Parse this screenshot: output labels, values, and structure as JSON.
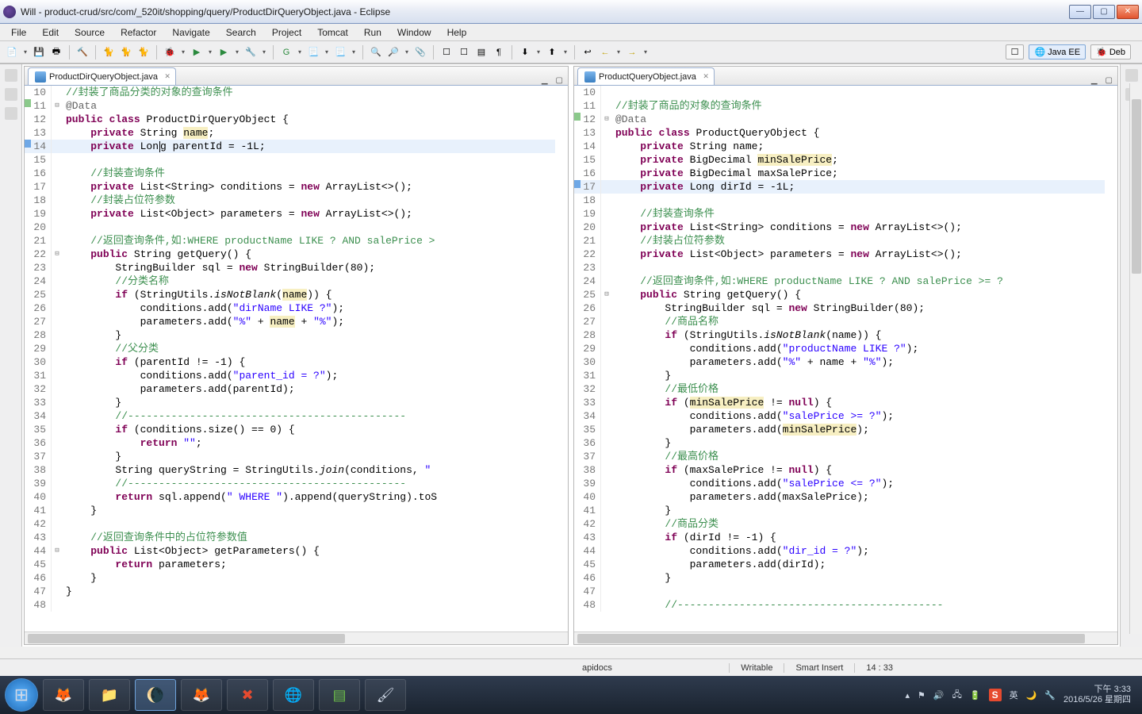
{
  "window": {
    "title": "Will - product-crud/src/com/_520it/shopping/query/ProductDirQueryObject.java - Eclipse",
    "min": "—",
    "max": "▢",
    "close": "✕"
  },
  "menu": [
    "File",
    "Edit",
    "Source",
    "Refactor",
    "Navigate",
    "Search",
    "Project",
    "Tomcat",
    "Run",
    "Window",
    "Help"
  ],
  "toolbar": {
    "icons": [
      "📄",
      "💾",
      "🖶",
      "🔨",
      "🏗",
      "🚀",
      "🐞",
      "🐈",
      "🔌",
      "📦",
      "G",
      "▶",
      "🔎",
      "🧩",
      "📎",
      "🔙",
      "🔜",
      "📂",
      "🔧",
      "⏯",
      "⏭",
      "⏮",
      "⬇",
      "⬆",
      "🔍",
      "🔗",
      "←",
      "→"
    ],
    "persp_open": "☐",
    "persp_javaee": "Java EE",
    "persp_debug": "Deb"
  },
  "left_tab": {
    "label": "ProductDirQueryObject.java",
    "close": "✕"
  },
  "right_tab": {
    "label": "ProductQueryObject.java",
    "close": "✕"
  },
  "status": {
    "apidocs": "apidocs",
    "writable": "Writable",
    "insert": "Smart Insert",
    "pos": "14 : 33"
  },
  "tray": {
    "ime": "S",
    "lang": "英",
    "ampm": "下午",
    "time": "3:33",
    "date": "2016/5/26 星期四"
  },
  "left_code": [
    {
      "n": 10,
      "cls": "",
      "fold": "",
      "html": "<span class='cm'>//封装了商品分类的对象的查询条件</span>"
    },
    {
      "n": 11,
      "cls": "",
      "fold": "⊟",
      "marker": "green",
      "html": "<span class='an'>@Data</span>"
    },
    {
      "n": 12,
      "cls": "",
      "fold": "",
      "html": "<span class='kw'>public</span> <span class='kw'>class</span> ProductDirQueryObject {"
    },
    {
      "n": 13,
      "cls": "",
      "fold": "",
      "html": "    <span class='kw'>private</span> String <span class='warn'>name</span>;"
    },
    {
      "n": 14,
      "cls": "hl",
      "fold": "",
      "marker": "blue",
      "html": "    <span class='kw'>private</span> Lon<span class='cursor'></span>g parentId = -1L;"
    },
    {
      "n": 15,
      "cls": "",
      "fold": "",
      "html": ""
    },
    {
      "n": 16,
      "cls": "",
      "fold": "",
      "html": "    <span class='cm'>//封装查询条件</span>"
    },
    {
      "n": 17,
      "cls": "",
      "fold": "",
      "html": "    <span class='kw'>private</span> List&lt;String&gt; conditions = <span class='kw'>new</span> ArrayList&lt;&gt;();"
    },
    {
      "n": 18,
      "cls": "",
      "fold": "",
      "html": "    <span class='cm'>//封装占位符参数</span>"
    },
    {
      "n": 19,
      "cls": "",
      "fold": "",
      "html": "    <span class='kw'>private</span> List&lt;Object&gt; parameters = <span class='kw'>new</span> ArrayList&lt;&gt;();"
    },
    {
      "n": 20,
      "cls": "",
      "fold": "",
      "html": ""
    },
    {
      "n": 21,
      "cls": "",
      "fold": "",
      "html": "    <span class='cm'>//返回查询条件,如:WHERE productName LIKE ? AND salePrice &gt;</span>"
    },
    {
      "n": 22,
      "cls": "",
      "fold": "⊟",
      "html": "    <span class='kw'>public</span> String getQuery() {"
    },
    {
      "n": 23,
      "cls": "",
      "fold": "",
      "html": "        StringBuilder sql = <span class='kw'>new</span> StringBuilder(80);"
    },
    {
      "n": 24,
      "cls": "",
      "fold": "",
      "html": "        <span class='cm'>//分类名称</span>"
    },
    {
      "n": 25,
      "cls": "",
      "fold": "",
      "html": "        <span class='kw'>if</span> (StringUtils.<span class='it'>isNotBlank</span>(<span class='warn'>name</span>)) {"
    },
    {
      "n": 26,
      "cls": "",
      "fold": "",
      "html": "            conditions.add(<span class='str'>\"dirName LIKE ?\"</span>);"
    },
    {
      "n": 27,
      "cls": "",
      "fold": "",
      "html": "            parameters.add(<span class='str'>\"%\"</span> + <span class='warn'>name</span> + <span class='str'>\"%\"</span>);"
    },
    {
      "n": 28,
      "cls": "",
      "fold": "",
      "html": "        }"
    },
    {
      "n": 29,
      "cls": "",
      "fold": "",
      "html": "        <span class='cm'>//父分类</span>"
    },
    {
      "n": 30,
      "cls": "",
      "fold": "",
      "html": "        <span class='kw'>if</span> (parentId != -1) {"
    },
    {
      "n": 31,
      "cls": "",
      "fold": "",
      "html": "            conditions.add(<span class='str'>\"parent_id = ?\"</span>);"
    },
    {
      "n": 32,
      "cls": "",
      "fold": "",
      "html": "            parameters.add(parentId);"
    },
    {
      "n": 33,
      "cls": "",
      "fold": "",
      "html": "        }"
    },
    {
      "n": 34,
      "cls": "",
      "fold": "",
      "html": "        <span class='cm'>//---------------------------------------------</span>"
    },
    {
      "n": 35,
      "cls": "",
      "fold": "",
      "html": "        <span class='kw'>if</span> (conditions.size() == 0) {"
    },
    {
      "n": 36,
      "cls": "",
      "fold": "",
      "html": "            <span class='kw'>return</span> <span class='str'>\"\"</span>;"
    },
    {
      "n": 37,
      "cls": "",
      "fold": "",
      "html": "        }"
    },
    {
      "n": 38,
      "cls": "",
      "fold": "",
      "html": "        String queryString = StringUtils.<span class='it'>join</span>(conditions, <span class='str'>\" </span>"
    },
    {
      "n": 39,
      "cls": "",
      "fold": "",
      "html": "        <span class='cm'>//---------------------------------------------</span>"
    },
    {
      "n": 40,
      "cls": "",
      "fold": "",
      "html": "        <span class='kw'>return</span> sql.append(<span class='str'>\" WHERE \"</span>).append(queryString).toS"
    },
    {
      "n": 41,
      "cls": "",
      "fold": "",
      "html": "    }"
    },
    {
      "n": 42,
      "cls": "",
      "fold": "",
      "html": ""
    },
    {
      "n": 43,
      "cls": "",
      "fold": "",
      "html": "    <span class='cm'>//返回查询条件中的占位符参数值</span>"
    },
    {
      "n": 44,
      "cls": "",
      "fold": "⊟",
      "html": "    <span class='kw'>public</span> List&lt;Object&gt; getParameters() {"
    },
    {
      "n": 45,
      "cls": "",
      "fold": "",
      "html": "        <span class='kw'>return</span> parameters;"
    },
    {
      "n": 46,
      "cls": "",
      "fold": "",
      "html": "    }"
    },
    {
      "n": 47,
      "cls": "",
      "fold": "",
      "html": "}"
    },
    {
      "n": 48,
      "cls": "",
      "fold": "",
      "html": ""
    }
  ],
  "right_code": [
    {
      "n": 10,
      "cls": "",
      "fold": "",
      "html": ""
    },
    {
      "n": 11,
      "cls": "",
      "fold": "",
      "html": "<span class='cm'>//封装了商品的对象的查询条件</span>"
    },
    {
      "n": 12,
      "cls": "",
      "fold": "⊟",
      "marker": "green",
      "html": "<span class='an'>@Data</span>"
    },
    {
      "n": 13,
      "cls": "",
      "fold": "",
      "html": "<span class='kw'>public</span> <span class='kw'>class</span> ProductQueryObject {"
    },
    {
      "n": 14,
      "cls": "",
      "fold": "",
      "html": "    <span class='kw'>private</span> String name;"
    },
    {
      "n": 15,
      "cls": "",
      "fold": "",
      "html": "    <span class='kw'>private</span> BigDecimal <span class='warn'>minSalePrice</span>;"
    },
    {
      "n": 16,
      "cls": "",
      "fold": "",
      "html": "    <span class='kw'>private</span> BigDecimal maxSalePrice;"
    },
    {
      "n": 17,
      "cls": "hl",
      "fold": "",
      "marker": "blue",
      "html": "    <span class='kw'>private</span> Long dirId = -1L;"
    },
    {
      "n": 18,
      "cls": "",
      "fold": "",
      "html": ""
    },
    {
      "n": 19,
      "cls": "",
      "fold": "",
      "html": "    <span class='cm'>//封装查询条件</span>"
    },
    {
      "n": 20,
      "cls": "",
      "fold": "",
      "html": "    <span class='kw'>private</span> List&lt;String&gt; conditions = <span class='kw'>new</span> ArrayList&lt;&gt;();"
    },
    {
      "n": 21,
      "cls": "",
      "fold": "",
      "html": "    <span class='cm'>//封装占位符参数</span>"
    },
    {
      "n": 22,
      "cls": "",
      "fold": "",
      "html": "    <span class='kw'>private</span> List&lt;Object&gt; parameters = <span class='kw'>new</span> ArrayList&lt;&gt;();"
    },
    {
      "n": 23,
      "cls": "",
      "fold": "",
      "html": ""
    },
    {
      "n": 24,
      "cls": "",
      "fold": "",
      "html": "    <span class='cm'>//返回查询条件,如:WHERE productName LIKE ? AND salePrice &gt;= ?</span>"
    },
    {
      "n": 25,
      "cls": "",
      "fold": "⊟",
      "html": "    <span class='kw'>public</span> String getQuery() {"
    },
    {
      "n": 26,
      "cls": "",
      "fold": "",
      "html": "        StringBuilder sql = <span class='kw'>new</span> StringBuilder(80);"
    },
    {
      "n": 27,
      "cls": "",
      "fold": "",
      "html": "        <span class='cm'>//商品名称</span>"
    },
    {
      "n": 28,
      "cls": "",
      "fold": "",
      "html": "        <span class='kw'>if</span> (StringUtils.<span class='it'>isNotBlank</span>(name)) {"
    },
    {
      "n": 29,
      "cls": "",
      "fold": "",
      "html": "            conditions.add(<span class='str'>\"productName LIKE ?\"</span>);"
    },
    {
      "n": 30,
      "cls": "",
      "fold": "",
      "html": "            parameters.add(<span class='str'>\"%\"</span> + name + <span class='str'>\"%\"</span>);"
    },
    {
      "n": 31,
      "cls": "",
      "fold": "",
      "html": "        }"
    },
    {
      "n": 32,
      "cls": "",
      "fold": "",
      "html": "        <span class='cm'>//最低价格</span>"
    },
    {
      "n": 33,
      "cls": "",
      "fold": "",
      "html": "        <span class='kw'>if</span> (<span class='warn'>minSalePrice</span> != <span class='kw'>null</span>) {"
    },
    {
      "n": 34,
      "cls": "",
      "fold": "",
      "html": "            conditions.add(<span class='str'>\"salePrice &gt;= ?\"</span>);"
    },
    {
      "n": 35,
      "cls": "",
      "fold": "",
      "html": "            parameters.add(<span class='warn'>minSalePrice</span>);"
    },
    {
      "n": 36,
      "cls": "",
      "fold": "",
      "html": "        }"
    },
    {
      "n": 37,
      "cls": "",
      "fold": "",
      "html": "        <span class='cm'>//最高价格</span>"
    },
    {
      "n": 38,
      "cls": "",
      "fold": "",
      "html": "        <span class='kw'>if</span> (maxSalePrice != <span class='kw'>null</span>) {"
    },
    {
      "n": 39,
      "cls": "",
      "fold": "",
      "html": "            conditions.add(<span class='str'>\"salePrice &lt;= ?\"</span>);"
    },
    {
      "n": 40,
      "cls": "",
      "fold": "",
      "html": "            parameters.add(maxSalePrice);"
    },
    {
      "n": 41,
      "cls": "",
      "fold": "",
      "html": "        }"
    },
    {
      "n": 42,
      "cls": "",
      "fold": "",
      "html": "        <span class='cm'>//商品分类</span>"
    },
    {
      "n": 43,
      "cls": "",
      "fold": "",
      "html": "        <span class='kw'>if</span> (dirId != -1) {"
    },
    {
      "n": 44,
      "cls": "",
      "fold": "",
      "html": "            conditions.add(<span class='str'>\"dir_id = ?\"</span>);"
    },
    {
      "n": 45,
      "cls": "",
      "fold": "",
      "html": "            parameters.add(dirId);"
    },
    {
      "n": 46,
      "cls": "",
      "fold": "",
      "html": "        }"
    },
    {
      "n": 47,
      "cls": "",
      "fold": "",
      "html": ""
    },
    {
      "n": 48,
      "cls": "",
      "fold": "",
      "html": "        <span class='cm'>//-------------------------------------------</span>"
    }
  ]
}
